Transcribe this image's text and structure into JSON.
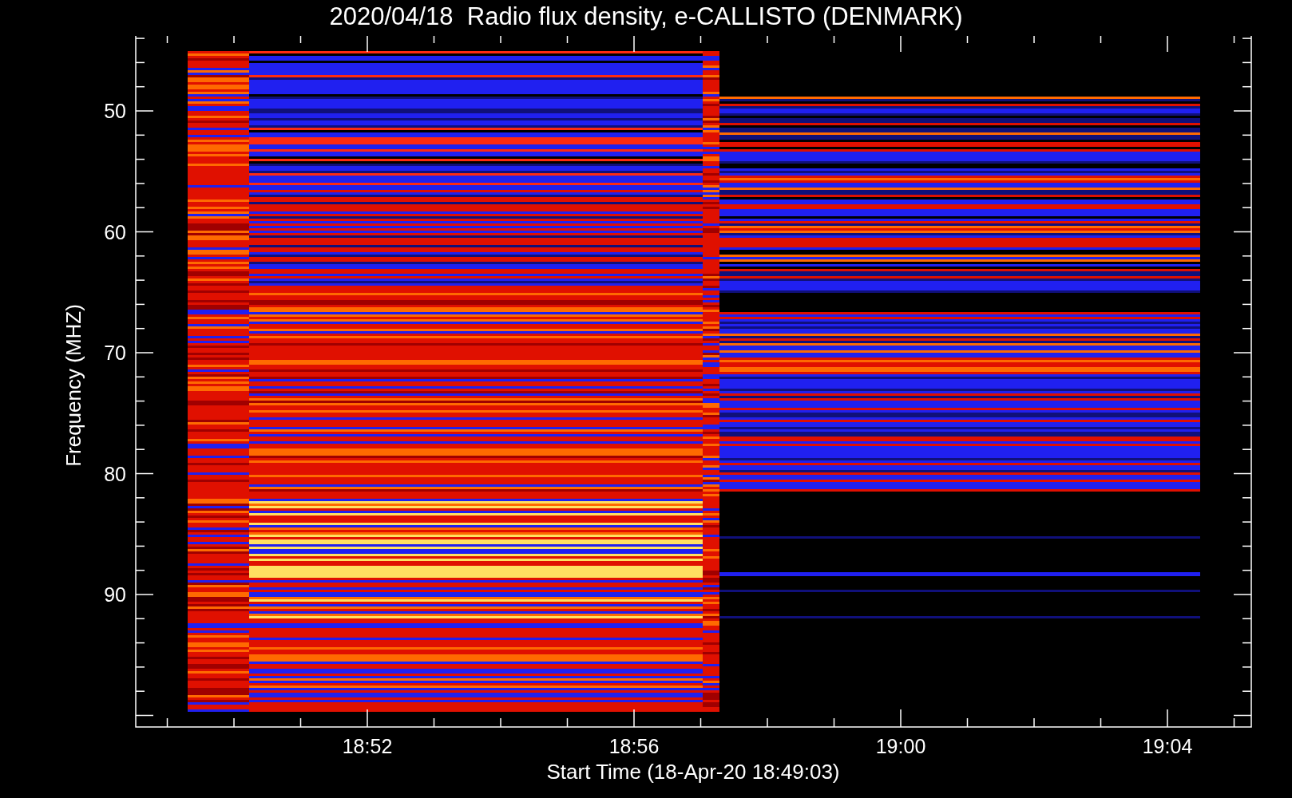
{
  "title": "2020/04/18  Radio flux density, e-CALLISTO (DENMARK)",
  "ylabel": "Frequency (MHZ)",
  "xlabel": "Start Time (18-Apr-20 18:49:03)",
  "yticks": [
    "50",
    "60",
    "70",
    "80",
    "90"
  ],
  "xticks": [
    "18:52",
    "18:56",
    "19:00",
    "19:04"
  ]
}
